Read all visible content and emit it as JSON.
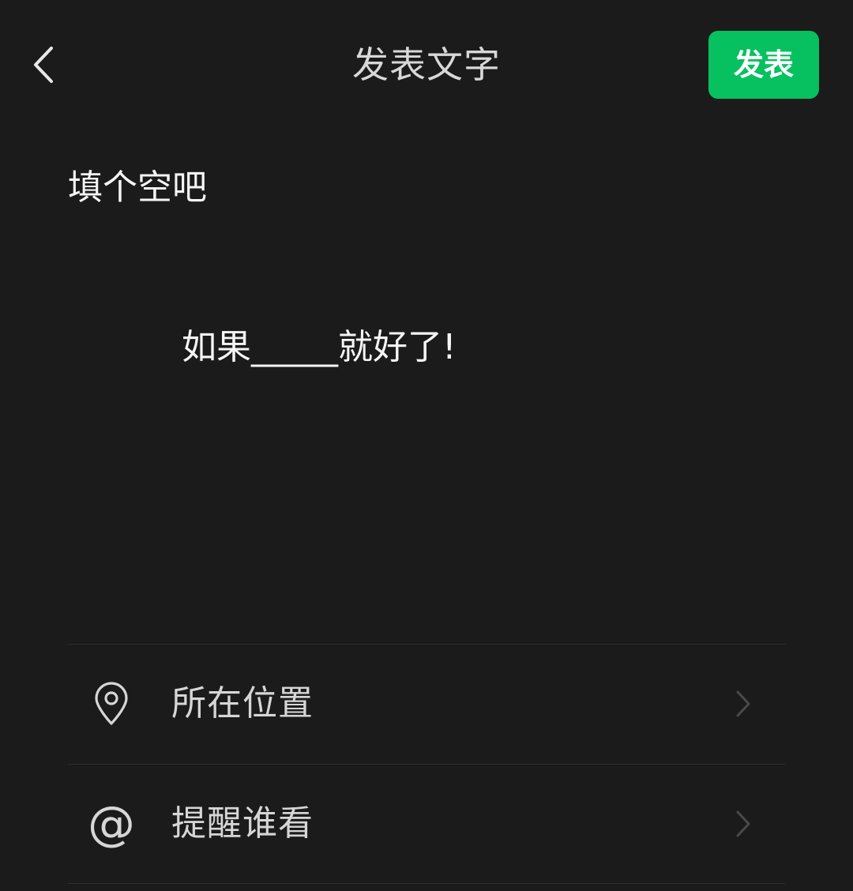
{
  "header": {
    "back_icon": "chevron-left-icon",
    "title": "发表文字",
    "publish_label": "发表",
    "publish_color": "#07c160"
  },
  "editor": {
    "lines": [
      "填个空吧",
      "如果_____就好了!"
    ]
  },
  "options": [
    {
      "icon": "location-pin-icon",
      "label": "所在位置",
      "chevron": "chevron-right-icon"
    },
    {
      "icon": "at-icon",
      "icon_glyph": "@",
      "label": "提醒谁看",
      "chevron": "chevron-right-icon"
    }
  ],
  "colors": {
    "background": "#1b1b1b",
    "accent": "#07c160",
    "text_primary": "#f5f5f5",
    "text_secondary": "#d6d6d6",
    "divider": "#2f2f2f"
  }
}
